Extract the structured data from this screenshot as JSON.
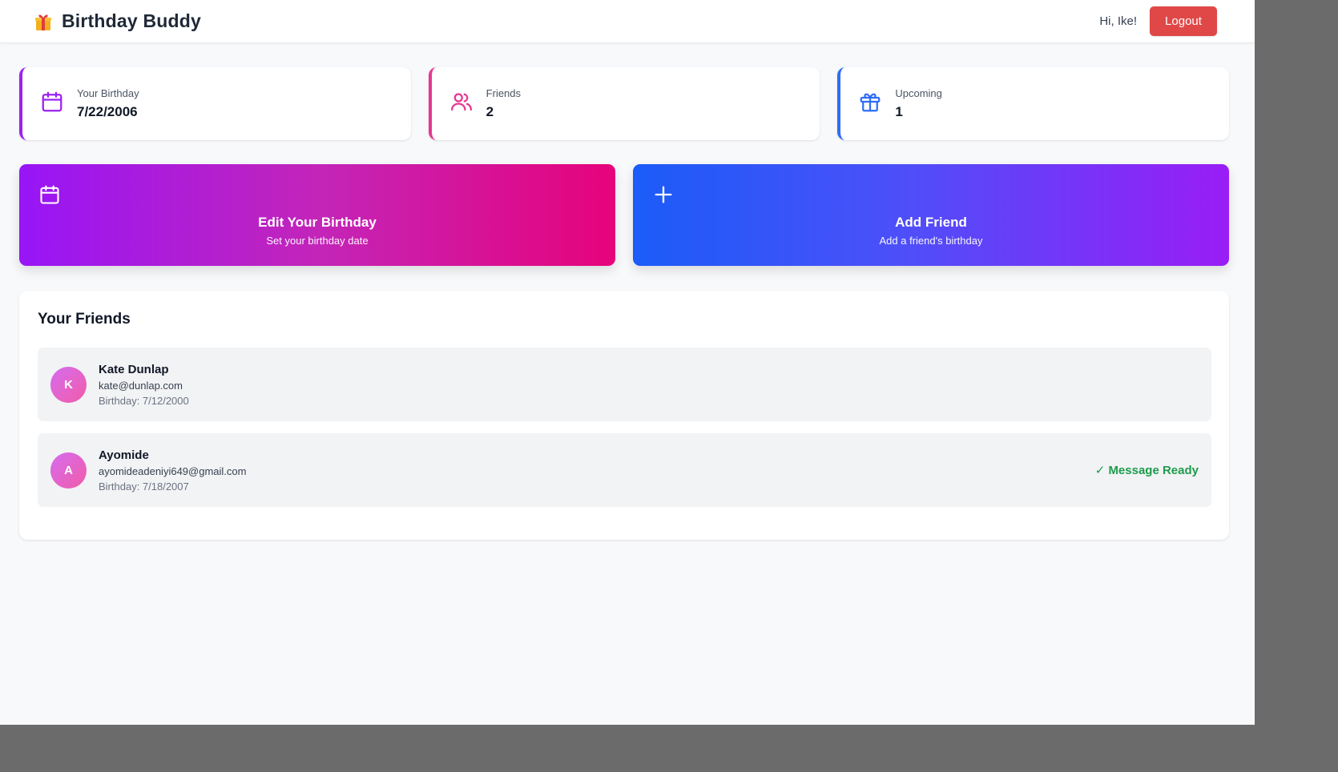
{
  "header": {
    "title": "Birthday Buddy",
    "brand_icon": "gift-emoji-icon",
    "greeting": "Hi, Ike!",
    "logout_label": "Logout"
  },
  "stats": [
    {
      "label": "Your Birthday",
      "value": "7/22/2006",
      "icon": "calendar-icon",
      "color": "#9b21f2"
    },
    {
      "label": "Friends",
      "value": "2",
      "icon": "users-icon",
      "color": "#e6378f"
    },
    {
      "label": "Upcoming",
      "value": "1",
      "icon": "gift-icon",
      "color": "#2f6df6"
    }
  ],
  "actions": [
    {
      "title": "Edit Your Birthday",
      "subtitle": "Set your birthday date",
      "icon": "calendar-icon"
    },
    {
      "title": "Add Friend",
      "subtitle": "Add a friend's birthday",
      "icon": "plus-icon"
    }
  ],
  "friends": {
    "title": "Your Friends",
    "items": [
      {
        "initial": "K",
        "name": "Kate Dunlap",
        "email": "kate@dunlap.com",
        "birthday": "Birthday: 7/12/2000",
        "status": ""
      },
      {
        "initial": "A",
        "name": "Ayomide",
        "email": "ayomideadeniyi649@gmail.com",
        "birthday": "Birthday: 7/18/2007",
        "status": "✓ Message Ready"
      }
    ]
  }
}
